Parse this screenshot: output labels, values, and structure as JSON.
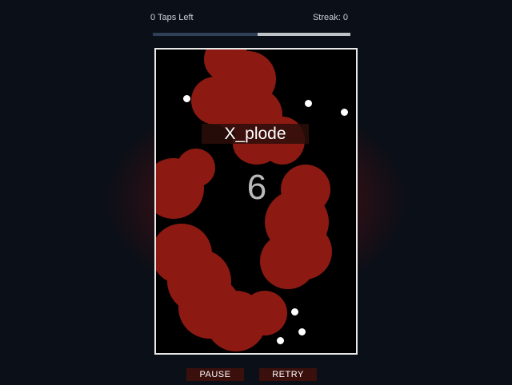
{
  "header": {
    "taps_left": "0 Taps Left",
    "streak": "Streak: 0",
    "progress": 0.53
  },
  "game": {
    "title": "X_plode",
    "counter": "6"
  },
  "controls": {
    "pause_label": "PAUSE",
    "retry_label": "RETRY"
  },
  "colors": {
    "background": "#0b0f17",
    "board": "#000000",
    "blob": "#8c1a12",
    "progress_fill": "#2e4057",
    "progress_track": "#bfc3c7",
    "button": "#3a0f0c"
  }
}
